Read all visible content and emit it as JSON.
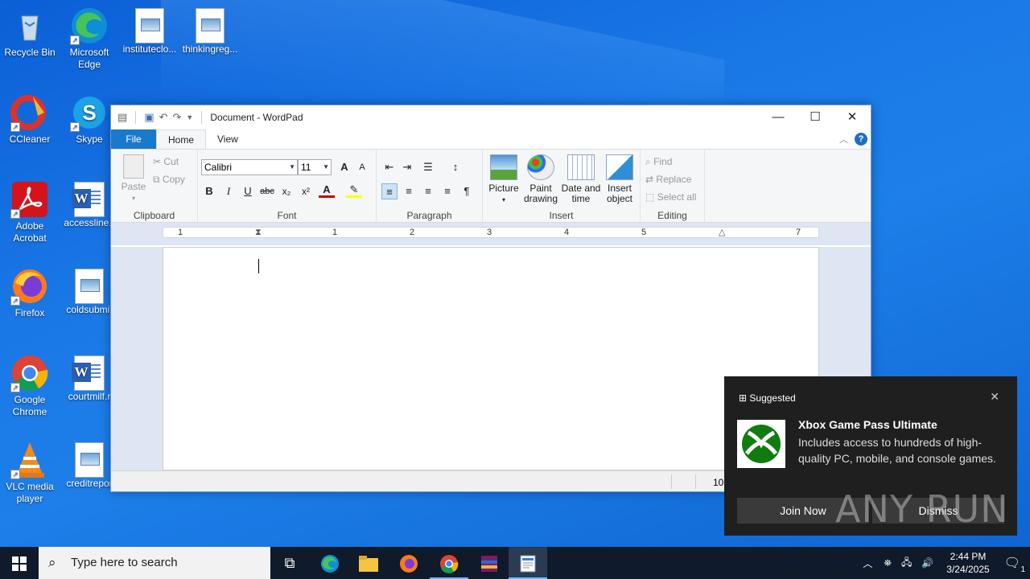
{
  "desktop": {
    "icons": [
      {
        "label": "Recycle Bin"
      },
      {
        "label": "Microsoft Edge"
      },
      {
        "label": "instituteclo..."
      },
      {
        "label": "thinkingreg..."
      },
      {
        "label": "CCleaner"
      },
      {
        "label": "Skype"
      },
      {
        "label": "Adobe Acrobat"
      },
      {
        "label": "accessline.r"
      },
      {
        "label": "Firefox"
      },
      {
        "label": "coldsubmit"
      },
      {
        "label": "Google Chrome"
      },
      {
        "label": "courtmilf.r"
      },
      {
        "label": "VLC media player"
      },
      {
        "label": "creditrepor"
      }
    ]
  },
  "window": {
    "title": "Document - WordPad",
    "tabs": {
      "file": "File",
      "home": "Home",
      "view": "View"
    },
    "help": "?",
    "clipboard": {
      "paste": "Paste",
      "cut": "Cut",
      "copy": "Copy",
      "label": "Clipboard"
    },
    "font": {
      "family": "Calibri",
      "size": "11",
      "label": "Font",
      "bold": "B",
      "italic": "I",
      "underline": "U",
      "strike": "abc",
      "sub": "x₂",
      "sup": "x²",
      "color": "A",
      "grow": "A",
      "shrink": "A"
    },
    "paragraph": {
      "label": "Paragraph"
    },
    "insert": {
      "picture": "Picture",
      "paint": "Paint drawing",
      "datetime": "Date and time",
      "object": "Insert object",
      "label": "Insert"
    },
    "editing": {
      "find": "Find",
      "replace": "Replace",
      "selectall": "Select all",
      "label": "Editing"
    },
    "ruler": [
      "1",
      "1",
      "2",
      "3",
      "4",
      "5",
      "7"
    ],
    "status": {
      "zoom": "10"
    }
  },
  "toast": {
    "header": "Suggested",
    "title": "Xbox Game Pass Ultimate",
    "body": "Includes access to hundreds of high-quality PC, mobile, and console games.",
    "join": "Join Now",
    "dismiss": "Dismiss"
  },
  "watermark": "ANY RUN",
  "taskbar": {
    "search_placeholder": "Type here to search",
    "time": "2:44 PM",
    "date": "3/24/2025",
    "notifications": "1"
  },
  "colors": {
    "accent": "#1979ca",
    "taskbar": "#0f1a2a",
    "toast": "#1f1f1f",
    "xbox": "#107c10"
  }
}
